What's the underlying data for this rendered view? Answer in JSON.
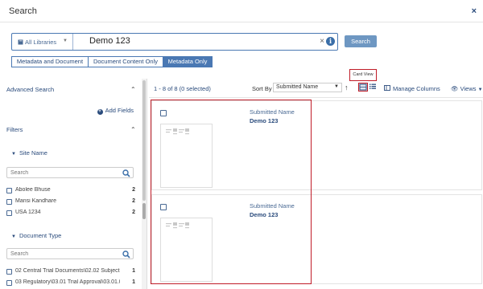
{
  "dialog": {
    "title": "Search",
    "close_glyph": "×"
  },
  "search": {
    "library_label": "All Libraries",
    "library_icon": "book-icon",
    "query": "Demo 123",
    "clear_glyph": "×",
    "info_glyph": "i",
    "button_label": "Search"
  },
  "modes": {
    "tabs": [
      {
        "label": "Metadata and Document",
        "active": false
      },
      {
        "label": "Document Content Only",
        "active": false
      },
      {
        "label": "Metadata Only",
        "active": true
      }
    ]
  },
  "tooltip": {
    "text": "Card View"
  },
  "sidebar": {
    "advanced_title": "Advanced Search",
    "add_fields_label": "Add Fields",
    "filters_title": "Filters",
    "site_name": {
      "title": "Site Name",
      "search_placeholder": "Search",
      "options": [
        {
          "label": "Abolee Bhuse",
          "count": "2"
        },
        {
          "label": "Mansi Kandhare",
          "count": "2"
        },
        {
          "label": "USA 1234",
          "count": "2"
        }
      ]
    },
    "document_type": {
      "title": "Document Type",
      "search_placeholder": "Search",
      "options": [
        {
          "label": "02 Central Trial Documents\\02.02 Subject ...",
          "count": "1"
        },
        {
          "label": "03 Regulatory\\03.01 Trial Approval\\03.01.0...",
          "count": "1"
        }
      ]
    }
  },
  "toolbar": {
    "count_text": "1 - 8 of 8 (0 selected)",
    "sort_by_label": "Sort By",
    "sort_value": "Submitted Name",
    "sort_arrow": "↑",
    "card_view_icon": "card-view-icon",
    "list_view_icon": "list-view-icon",
    "manage_columns_label": "Manage Columns",
    "views_label": "Views"
  },
  "results": {
    "cards": [
      {
        "field_label": "Submitted Name",
        "field_value": "Demo 123"
      },
      {
        "field_label": "Submitted Name",
        "field_value": "Demo 123"
      }
    ]
  },
  "colors": {
    "accent": "#4a78b3",
    "link": "#2a4b7c",
    "highlight": "#c01c28",
    "search_button": "#6e97c2"
  }
}
